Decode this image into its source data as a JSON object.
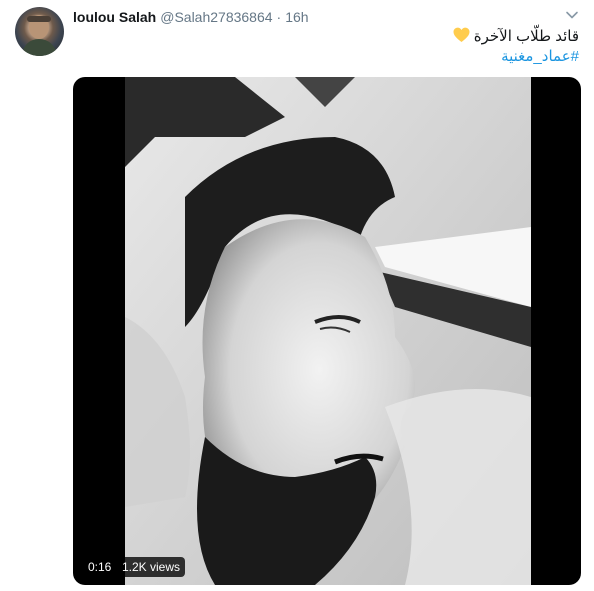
{
  "user": {
    "display_name": "loulou Salah",
    "handle": "@Salah27836864",
    "separator": "·",
    "time_ago": "16h"
  },
  "tweet": {
    "text_line1": "قائد طلّاب الآخرة",
    "emoji": "yellow-heart-icon",
    "hashtag": "#عماد_مغنية"
  },
  "video": {
    "duration": "0:16",
    "views": "1.2K views"
  },
  "colors": {
    "link": "#1b95e0",
    "secondary_text": "#657786",
    "heart": "#ffcc4d"
  }
}
